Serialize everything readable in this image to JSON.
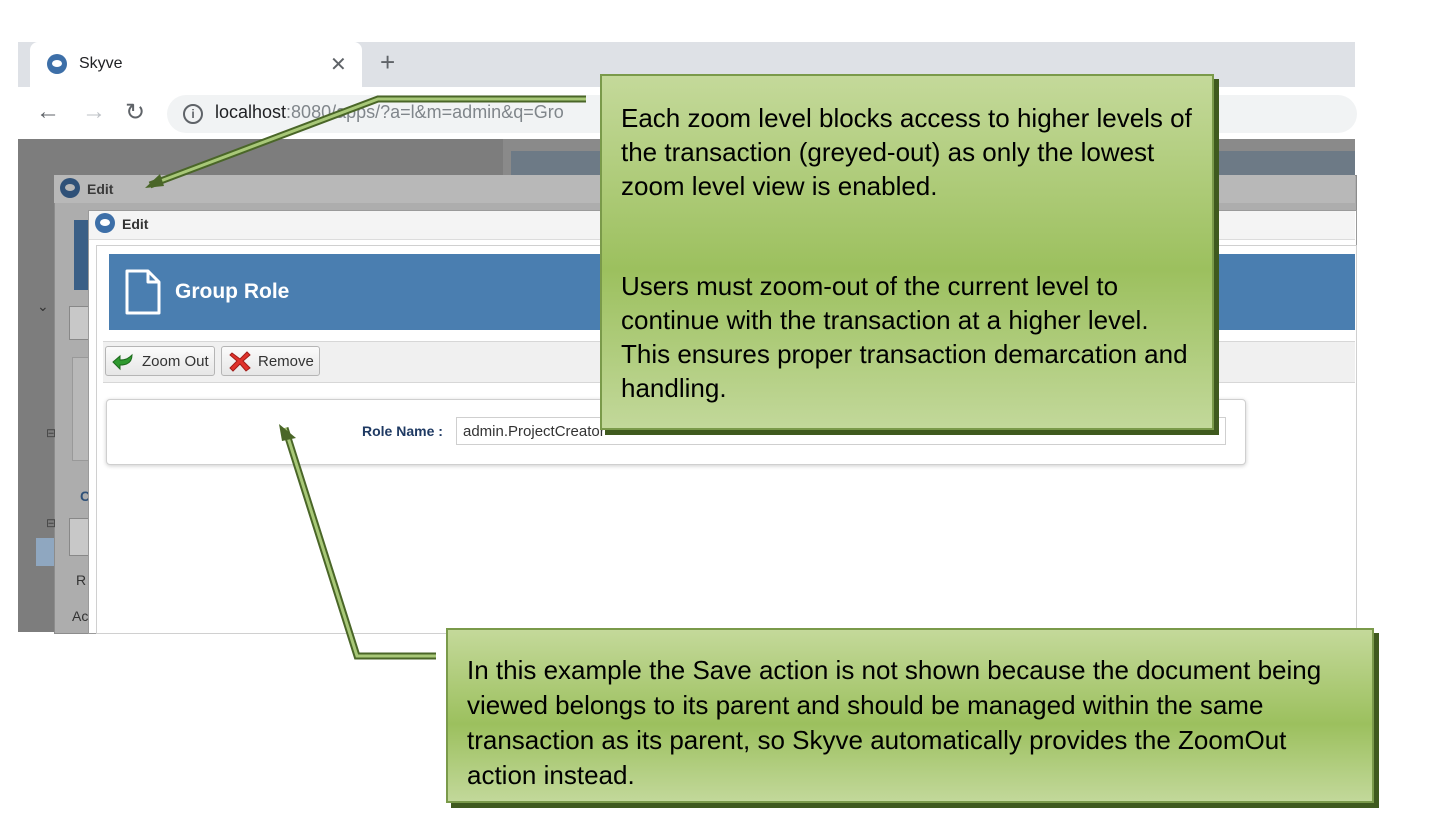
{
  "browser": {
    "tab_title": "Skyve",
    "tab_close": "✕",
    "new_tab": "+",
    "url_host": "localhost",
    "url_rest": ":8080/apps/?a=l&m=admin&q=Gro",
    "info_glyph": "i"
  },
  "outer_dialog": {
    "title": "Edit"
  },
  "inner_dialog": {
    "title": "Edit"
  },
  "page": {
    "title": "Group Role"
  },
  "actions": {
    "zoom_out": "Zoom Out",
    "remove": "Remove"
  },
  "form": {
    "role_name_label": "Role Name :",
    "role_name_value": "admin.ProjectCreator"
  },
  "callouts": {
    "top_paragraph_1": "Each zoom level blocks access to higher levels of the transaction (greyed-out) as only the lowest zoom level view is enabled.",
    "top_paragraph_2": "Users must zoom-out of the current level to continue with the transaction at a higher level. This ensures proper transaction demarcation and handling.",
    "bottom": "In this example the Save action is not shown because the document being viewed belongs to its parent and should be managed within the same transaction as its parent, so Skyve automatically provides the ZoomOut action instead."
  },
  "colors": {
    "banner": "#4a7eb0",
    "callout_green": "#9cc05e",
    "label_navy": "#1f3a63"
  }
}
